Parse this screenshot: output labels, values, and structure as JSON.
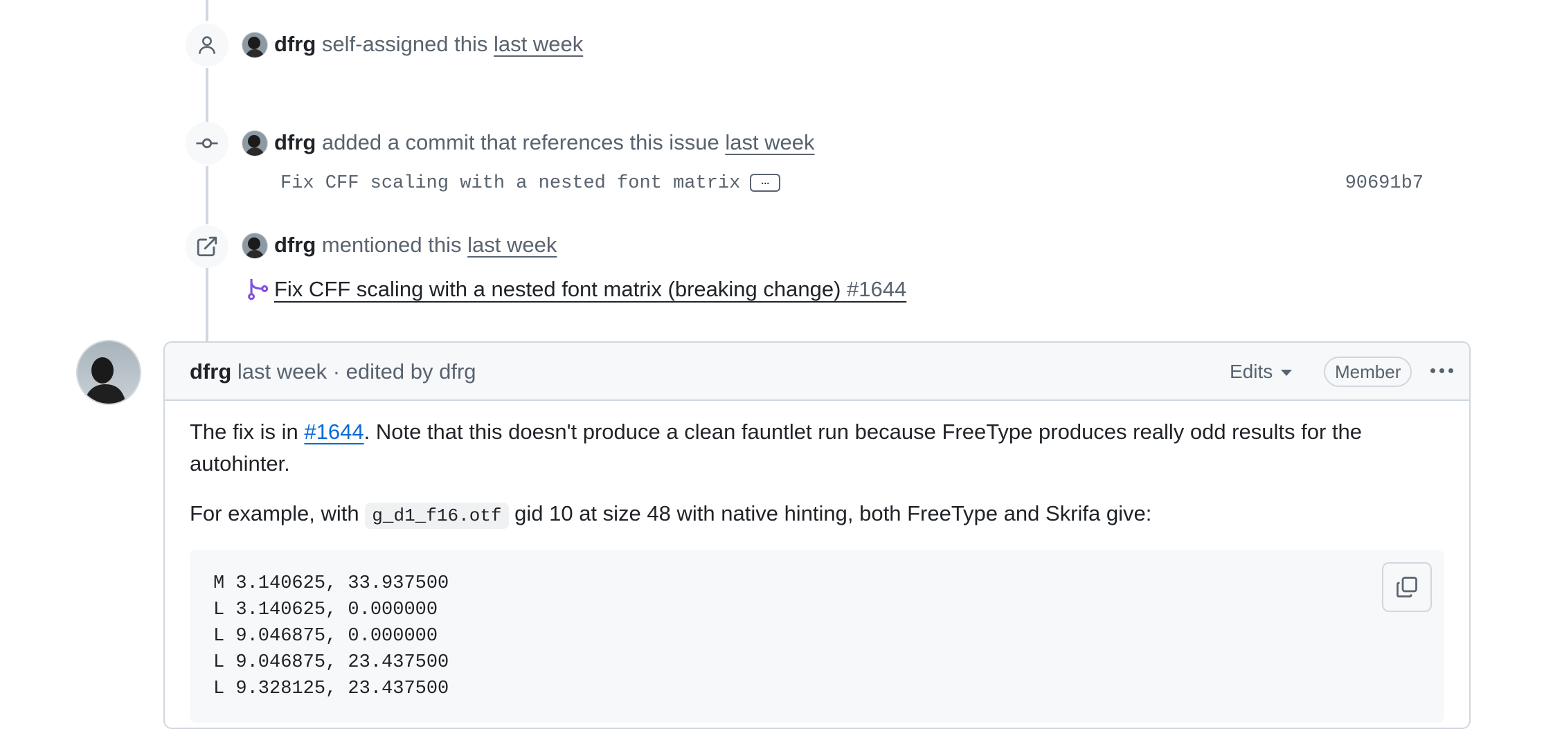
{
  "timeline": {
    "events": [
      {
        "actor": "dfrg",
        "action": "self-assigned this",
        "time": "last week"
      },
      {
        "actor": "dfrg",
        "action": "added a commit that references this issue",
        "time": "last week",
        "commit_message": "Fix CFF scaling with a nested font matrix",
        "commit_ellipsis": "…",
        "commit_sha": "90691b7"
      },
      {
        "actor": "dfrg",
        "action": "mentioned this",
        "time": "last week",
        "pr_title": "Fix CFF scaling with a nested font matrix (breaking change)",
        "pr_number": "#1644"
      }
    ]
  },
  "comment": {
    "author": "dfrg",
    "meta": "last week · edited by dfrg",
    "edits_label": "Edits",
    "role_badge": "Member",
    "p1_before": "The fix is in ",
    "p1_link": "#1644",
    "p1_after": ". Note that this doesn't produce a clean fauntlet run because FreeType produces really odd results for the autohinter.",
    "p2_before": "For example, with ",
    "p2_code": "g_d1_f16.otf",
    "p2_after": " gid 10 at size 48 with native hinting, both FreeType and Skrifa give:",
    "code_lines": [
      "M 3.140625, 33.937500",
      "L 3.140625, 0.000000",
      "L 9.046875, 0.000000",
      "L 9.046875, 23.437500",
      "L 9.328125, 23.437500"
    ]
  },
  "colors": {
    "text": "#1f2328",
    "muted": "#59636e",
    "border": "#d0d7de",
    "link": "#0969da",
    "merged_purple": "#8250df"
  }
}
